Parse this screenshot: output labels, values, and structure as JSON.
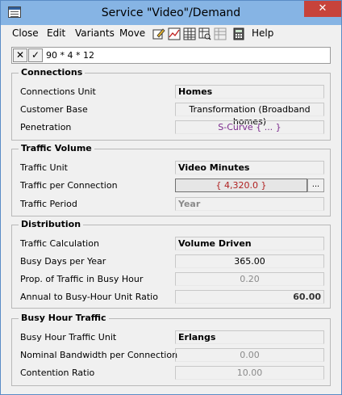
{
  "window": {
    "title": "Service \"Video\"/Demand",
    "close_glyph": "✕"
  },
  "menu": {
    "items": [
      "Close",
      "Edit",
      "Variants",
      "Move"
    ],
    "help": "Help",
    "toolbar_icons": [
      "edit-form-icon",
      "chart-icon",
      "table-icon",
      "grid-search-icon",
      "grid-disabled-icon",
      "calculator-icon"
    ]
  },
  "formula": {
    "cancel_glyph": "✕",
    "accept_glyph": "✓",
    "value": "90 * 4 * 12"
  },
  "connections": {
    "title": "Connections",
    "unit_label": "Connections Unit",
    "unit_value": "Homes",
    "base_label": "Customer Base",
    "base_value": "Transformation (Broadband homes)",
    "penetration_label": "Penetration",
    "penetration_value": "S-Curve { ... }"
  },
  "traffic_volume": {
    "title": "Traffic Volume",
    "unit_label": "Traffic Unit",
    "unit_value": "Video Minutes",
    "per_conn_label": "Traffic per Connection",
    "per_conn_value": "{ 4,320.0 }",
    "dots": "...",
    "period_label": "Traffic Period",
    "period_value": "Year"
  },
  "distribution": {
    "title": "Distribution",
    "calc_label": "Traffic Calculation",
    "calc_value": "Volume Driven",
    "busy_days_label": "Busy Days per Year",
    "busy_days_value": "365.00",
    "prop_label": "Prop. of Traffic in Busy Hour",
    "prop_value": "0.20",
    "ratio_label": "Annual to Busy-Hour Unit Ratio",
    "ratio_value": "60.00"
  },
  "busy_hour": {
    "title": "Busy Hour Traffic",
    "unit_label": "Busy Hour Traffic Unit",
    "unit_value": "Erlangs",
    "bandwidth_label": "Nominal Bandwidth per Connection",
    "bandwidth_value": "0.00",
    "contention_label": "Contention Ratio",
    "contention_value": "10.00"
  }
}
